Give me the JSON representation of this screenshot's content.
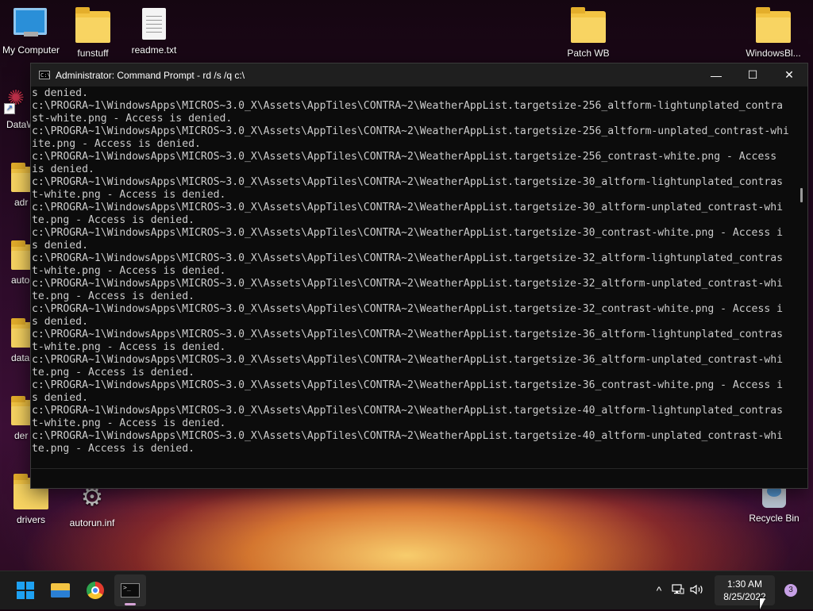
{
  "desktop": {
    "icons": {
      "my_computer": "My Computer",
      "funstuff": "funstuff",
      "readme": "readme.txt",
      "patch_wb": "Patch WB",
      "windowsbl": "WindowsBl...",
      "dataw": "DataW",
      "adr": "adr",
      "auto": "auto",
      "data": "data",
      "der": "der",
      "drivers": "drivers",
      "autorun": "autorun.inf",
      "recycle_bin": "Recycle Bin"
    }
  },
  "window": {
    "title": "Administrator: Command Prompt - rd  /s /q c:\\",
    "minimize": "—",
    "maximize": "☐",
    "close": "✕",
    "console_lines": [
      "s denied.",
      "c:\\PROGRA~1\\WindowsApps\\MICROS~3.0_X\\Assets\\AppTiles\\CONTRA~2\\WeatherAppList.targetsize-256_altform-lightunplated_contra",
      "st-white.png - Access is denied.",
      "c:\\PROGRA~1\\WindowsApps\\MICROS~3.0_X\\Assets\\AppTiles\\CONTRA~2\\WeatherAppList.targetsize-256_altform-unplated_contrast-whi",
      "ite.png - Access is denied.",
      "c:\\PROGRA~1\\WindowsApps\\MICROS~3.0_X\\Assets\\AppTiles\\CONTRA~2\\WeatherAppList.targetsize-256_contrast-white.png - Access",
      "is denied.",
      "c:\\PROGRA~1\\WindowsApps\\MICROS~3.0_X\\Assets\\AppTiles\\CONTRA~2\\WeatherAppList.targetsize-30_altform-lightunplated_contras",
      "t-white.png - Access is denied.",
      "c:\\PROGRA~1\\WindowsApps\\MICROS~3.0_X\\Assets\\AppTiles\\CONTRA~2\\WeatherAppList.targetsize-30_altform-unplated_contrast-whi",
      "te.png - Access is denied.",
      "c:\\PROGRA~1\\WindowsApps\\MICROS~3.0_X\\Assets\\AppTiles\\CONTRA~2\\WeatherAppList.targetsize-30_contrast-white.png - Access i",
      "s denied.",
      "c:\\PROGRA~1\\WindowsApps\\MICROS~3.0_X\\Assets\\AppTiles\\CONTRA~2\\WeatherAppList.targetsize-32_altform-lightunplated_contras",
      "t-white.png - Access is denied.",
      "c:\\PROGRA~1\\WindowsApps\\MICROS~3.0_X\\Assets\\AppTiles\\CONTRA~2\\WeatherAppList.targetsize-32_altform-unplated_contrast-whi",
      "te.png - Access is denied.",
      "c:\\PROGRA~1\\WindowsApps\\MICROS~3.0_X\\Assets\\AppTiles\\CONTRA~2\\WeatherAppList.targetsize-32_contrast-white.png - Access i",
      "s denied.",
      "c:\\PROGRA~1\\WindowsApps\\MICROS~3.0_X\\Assets\\AppTiles\\CONTRA~2\\WeatherAppList.targetsize-36_altform-lightunplated_contras",
      "t-white.png - Access is denied.",
      "c:\\PROGRA~1\\WindowsApps\\MICROS~3.0_X\\Assets\\AppTiles\\CONTRA~2\\WeatherAppList.targetsize-36_altform-unplated_contrast-whi",
      "te.png - Access is denied.",
      "c:\\PROGRA~1\\WindowsApps\\MICROS~3.0_X\\Assets\\AppTiles\\CONTRA~2\\WeatherAppList.targetsize-36_contrast-white.png - Access i",
      "s denied.",
      "c:\\PROGRA~1\\WindowsApps\\MICROS~3.0_X\\Assets\\AppTiles\\CONTRA~2\\WeatherAppList.targetsize-40_altform-lightunplated_contras",
      "t-white.png - Access is denied.",
      "c:\\PROGRA~1\\WindowsApps\\MICROS~3.0_X\\Assets\\AppTiles\\CONTRA~2\\WeatherAppList.targetsize-40_altform-unplated_contrast-whi",
      "te.png - Access is denied."
    ]
  },
  "taskbar": {
    "apps": [
      "start-icon",
      "file-explorer-icon",
      "chrome-icon",
      "terminal-icon"
    ],
    "tray": {
      "chevron": "^",
      "time": "1:30 AM",
      "date": "8/25/2022",
      "notification_count": "3"
    }
  },
  "colors": {
    "console_bg": "#0c0c0c",
    "console_fg": "#cccccc",
    "taskbar_bg": "#1c1c1c",
    "accent": "#1ea1f2"
  }
}
